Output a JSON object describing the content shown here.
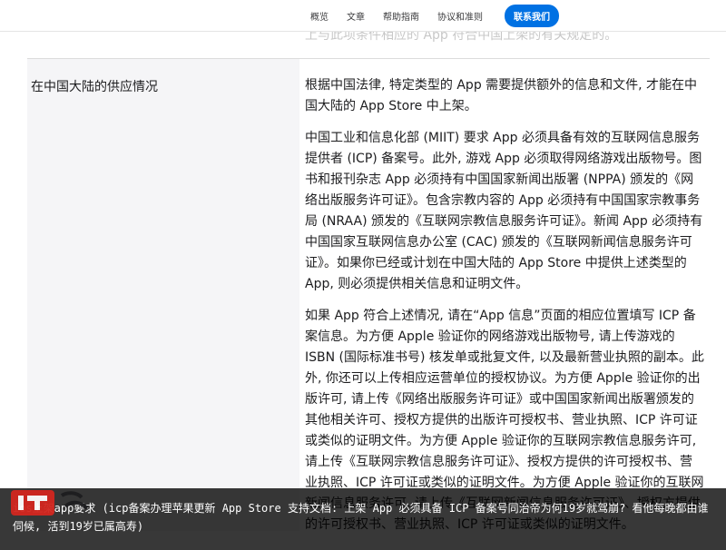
{
  "nav": {
    "links": [
      "概览",
      "文章",
      "帮助指南",
      "协议和准则"
    ],
    "cta": "联系我们"
  },
  "content": {
    "prev_line": "上与此项条件相应的 App 符合中国上架的有关规定的。",
    "section_title": "在中国大陆的供应情况",
    "paras": [
      "根据中国法律, 特定类型的 App 需要提供额外的信息和文件, 才能在中国大陆的 App Store 中上架。",
      "中国工业和信息化部 (MIIT) 要求 App 必须具备有效的互联网信息服务提供者 (ICP) 备案号。此外, 游戏 App 必须取得网络游戏出版物号。图书和报刊杂志 App 必须持有中国国家新闻出版署 (NPPA) 颁发的《网络出版服务许可证》。包含宗教内容的 App 必须持有中国国家宗教事务局 (NRAA) 颁发的《互联网宗教信息服务许可证》。新闻 App 必须持有中国国家互联网信息办公室 (CAC) 颁发的《互联网新闻信息服务许可证》。如果你已经或计划在中国大陆的 App Store 中提供上述类型的 App, 则必须提供相关信息和证明文件。",
      "如果 App 符合上述情况, 请在“App 信息”页面的相应位置填写 ICP 备案信息。为方便 Apple 验证你的网络游戏出版物号, 请上传游戏的 ISBN (国际标准书号) 核发单或批复文件, 以及最新营业执照的副本。此外, 你还可以上传相应运营单位的授权协议。为方便 Apple 验证你的出版许可, 请上传《网络出版服务许可证》或中国国家新闻出版署颁发的其他相关许可、授权方提供的出版许可授权书、营业执照、ICP 许可证或类似的证明文件。为方便 Apple 验证你的互联网宗教信息服务许可, 请上传《互联网宗教信息服务许可证》、授权方提供的许可授权书、营业执照、ICP 许可证或类似的证明文件。为方便 Apple 验证你的互联网新闻信息服务许可, 请上传《互联网新闻信息服务许可证》、授权方提供的许可授权书、营业执照、ICP 许可证或类似的证明文件。"
    ]
  },
  "overlay": {
    "text": "ios上架app要求 (icp备案办理苹果更新 App Store 支持文档: 上架 App 必须具备 ICP 备案号同治帝为何19岁就驾崩? 看他每晚都由谁伺候, 活到19岁已属高寿)"
  },
  "watermark": {
    "icon": "it-home-logo"
  }
}
